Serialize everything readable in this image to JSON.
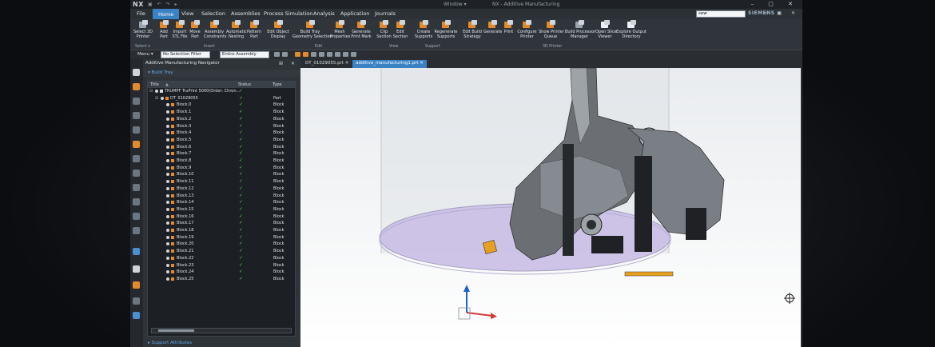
{
  "titlebar": {
    "logo": "NX",
    "quick_access": "▣ ↶ ↷ ▸",
    "window_menu": "Window ▾",
    "app_title": "NX - Additive Manufacturing",
    "window_controls": "– ▢ ✕"
  },
  "menubar": {
    "tabs": [
      "File",
      "Home",
      "View",
      "Selection",
      "Assemblies",
      "Process Simulation",
      "Analysis",
      "Application",
      "Journals"
    ],
    "active_tab": "Home",
    "search_value": "sew",
    "brand": "SIEMENS",
    "right_controls": "▭ ▣ ✕"
  },
  "ribbon": {
    "buttons": [
      {
        "label": "Select 3D\nPrinter",
        "icon": "printer-select-icon"
      },
      {
        "label": "Add\nPart",
        "icon": "add-part-icon"
      },
      {
        "label": "Import\nSTL File",
        "icon": "import-stl-icon"
      },
      {
        "label": "Move\nPart",
        "icon": "move-part-icon"
      },
      {
        "label": "Assembly\nConstraints",
        "icon": "assembly-constraints-icon"
      },
      {
        "label": "Automatic\nNesting",
        "icon": "automatic-nesting-icon"
      },
      {
        "label": "Pattern\nPart",
        "icon": "pattern-part-icon"
      },
      {
        "label": "Edit Object\nDisplay",
        "icon": "edit-object-display-icon"
      },
      {
        "label": "Build Tray\nGeometry Selection",
        "icon": "build-tray-icon"
      },
      {
        "label": "Mesh\nProperties",
        "icon": "mesh-properties-icon"
      },
      {
        "label": "Generate\nPrint Mark",
        "icon": "print-mark-icon"
      },
      {
        "label": "Clip\nSection",
        "icon": "clip-section-icon"
      },
      {
        "label": "Edit\nSection",
        "icon": "edit-section-icon"
      },
      {
        "label": "Create\nSupports",
        "icon": "create-supports-icon"
      },
      {
        "label": "Regenerate\nSupports",
        "icon": "regenerate-supports-icon"
      },
      {
        "label": "Edit Build\nStrategy",
        "icon": "build-strategy-icon"
      },
      {
        "label": "Generate",
        "icon": "generate-icon"
      },
      {
        "label": "Print",
        "icon": "print-icon"
      },
      {
        "label": "Configure\nPrinter",
        "icon": "configure-printer-icon"
      },
      {
        "label": "Show Printer\nQueue",
        "icon": "printer-queue-icon"
      },
      {
        "label": "Build Processor\nManager",
        "icon": "build-processor-icon"
      },
      {
        "label": "Open Slice\nViewer",
        "icon": "slice-viewer-icon"
      },
      {
        "label": "Explore Output\nDirectory",
        "icon": "output-directory-icon"
      }
    ],
    "groups": [
      "Select ▾",
      "Insert",
      "Edit",
      "View",
      "Support",
      "3D Printer"
    ]
  },
  "toolbar": {
    "menu_label": "Menu ▾",
    "selection_filter": "No Selection Filter",
    "assembly_scope": "Entire Assembly"
  },
  "navigator": {
    "title": "Additive Manufacturing Navigator",
    "section": "▾ Build Tray",
    "columns": {
      "title": "Title",
      "status": "Status",
      "type": "Type"
    },
    "root": {
      "title": "TRUMPF TruPrint 5000(Order: Chron...",
      "status": "✓"
    },
    "part": {
      "title": "DT_01029055",
      "status": "✓",
      "type": "Part"
    },
    "blocks": [
      "Block.0",
      "Block.1",
      "Block.2",
      "Block.3",
      "Block.4",
      "Block.5",
      "Block.6",
      "Block.7",
      "Block.8",
      "Block.9",
      "Block.10",
      "Block.11",
      "Block.12",
      "Block.13",
      "Block.14",
      "Block.15",
      "Block.16",
      "Block.17",
      "Block.18",
      "Block.19",
      "Block.20",
      "Block.21",
      "Block.22",
      "Block.23",
      "Block.24",
      "Block.25"
    ],
    "block_type": "Block",
    "block_status": "✓",
    "bottom_section": "▸ Support Attributes"
  },
  "doc_tabs": [
    {
      "label": "DT_01029055.prt ✕",
      "active": false
    },
    {
      "label": "additive_manufacturing1.prt ✕",
      "active": true
    }
  ],
  "colors": {
    "accent": "#3b82c4",
    "status_ok": "#5fd35a",
    "icon_orange": "#e38b2c",
    "tray": "#c9bfe6"
  }
}
